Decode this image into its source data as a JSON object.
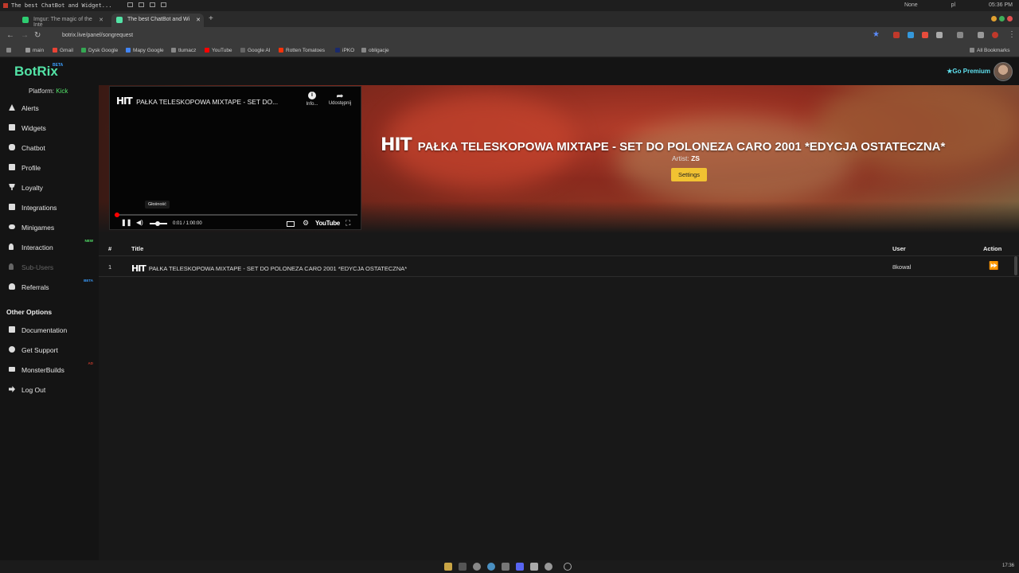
{
  "os": {
    "window_title": "The best ChatBot and Widget...",
    "status_none": "None",
    "keyboard": "pl",
    "datetime": "05:36 PM"
  },
  "browser": {
    "tabs": [
      {
        "label": "Imgur: The magic of the Inte"
      },
      {
        "label": "The best ChatBot and Wi"
      }
    ],
    "url": "botrix.live/panel/songrequest",
    "bookmarks": [
      "main",
      "Gmail",
      "Dysk Google",
      "Mapy Google",
      "tlumacz",
      "YouTube",
      "Google AI",
      "Rotten Tomatoes",
      "iPKO",
      "obligacje"
    ],
    "all_bookmarks": "All Bookmarks"
  },
  "app": {
    "logo": "BotRix",
    "logo_badge": "BETA",
    "go_premium": "Go Premium"
  },
  "sidebar": {
    "platform_label": "Platform:",
    "platform_value": "Kick",
    "items": [
      {
        "label": "Alerts",
        "icon": "warning-icon"
      },
      {
        "label": "Widgets",
        "icon": "grid-icon"
      },
      {
        "label": "Chatbot",
        "icon": "robot-icon"
      },
      {
        "label": "Profile",
        "icon": "id-card-icon"
      },
      {
        "label": "Loyalty",
        "icon": "trophy-icon"
      },
      {
        "label": "Integrations",
        "icon": "link-icon"
      },
      {
        "label": "Minigames",
        "icon": "gamepad-icon"
      },
      {
        "label": "Interaction",
        "icon": "music-icon",
        "badge": "NEW"
      },
      {
        "label": "Sub-Users",
        "icon": "music-icon"
      },
      {
        "label": "Referrals",
        "icon": "users-icon",
        "badge": "BETA"
      }
    ],
    "other_heading": "Other Options",
    "other_items": [
      {
        "label": "Documentation",
        "icon": "book-icon"
      },
      {
        "label": "Get Support",
        "icon": "question-icon"
      },
      {
        "label": "MonsterBuilds",
        "icon": "laptop-icon",
        "badge": "AD"
      },
      {
        "label": "Log Out",
        "icon": "logout-icon"
      }
    ]
  },
  "player": {
    "logo_text": "HIT",
    "title": "PAŁKA TELESKOPOWA MIXTAPE - SET DO...",
    "info_label": "Info...",
    "share_label": "Udostępnij",
    "tooltip": "Głośność",
    "time": "0:01 / 1:00:00",
    "progress_fraction": 0.003,
    "volume_fraction": 0.4,
    "youtube_label": "YouTube"
  },
  "now_playing": {
    "logo_text": "HIT",
    "title": "PAŁKA TELESKOPOWA MIXTAPE - SET DO POLONEZA CARO 2001 *EDYCJA OSTATECZNA*",
    "artist_label": "Artist:",
    "artist": "ZS",
    "settings_button": "Settings"
  },
  "queue": {
    "headers": {
      "num": "#",
      "title": "Title",
      "user": "User",
      "action": "Action"
    },
    "rows": [
      {
        "num": "1",
        "logo_text": "HIT",
        "title": "PAŁKA TELESKOPOWA MIXTAPE - SET DO POLONEZA CARO 2001 *EDYCJA OSTATECZNA*",
        "user": "8kowal",
        "action_icon": "skip-forward-icon"
      }
    ]
  },
  "taskbar": {
    "clock": "17:36"
  },
  "colors": {
    "accent_green": "#53e3a6",
    "premium_cyan": "#5fe0ee",
    "settings_yellow": "#f1c232",
    "progress_red": "#ff0000"
  }
}
